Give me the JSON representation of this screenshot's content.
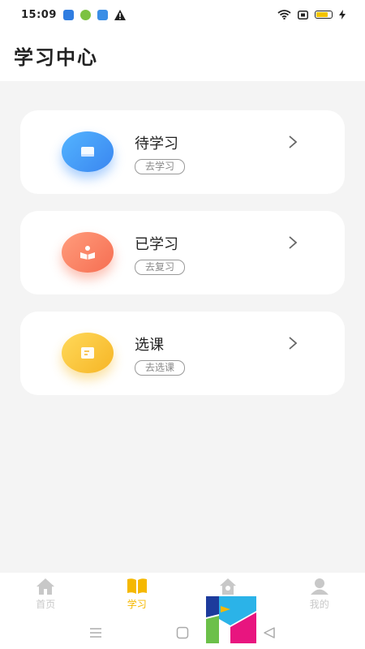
{
  "status": {
    "time": "15:09"
  },
  "header": {
    "title": "学习中心"
  },
  "cards": [
    {
      "title": "待学习",
      "action": "去学习",
      "icon": "book-icon",
      "color": "#3a86f0"
    },
    {
      "title": "已学习",
      "action": "去复习",
      "icon": "reader-icon",
      "color": "#f66e52"
    },
    {
      "title": "选课",
      "action": "去选课",
      "icon": "document-icon",
      "color": "#f6b525"
    }
  ],
  "tabs": [
    {
      "label": "首页",
      "icon": "home-icon",
      "active": false
    },
    {
      "label": "学习",
      "icon": "open-book-icon",
      "active": true
    },
    {
      "label": "",
      "icon": "house-icon",
      "active": false
    },
    {
      "label": "我的",
      "icon": "person-icon",
      "active": false
    }
  ],
  "accent": "#f5b800"
}
